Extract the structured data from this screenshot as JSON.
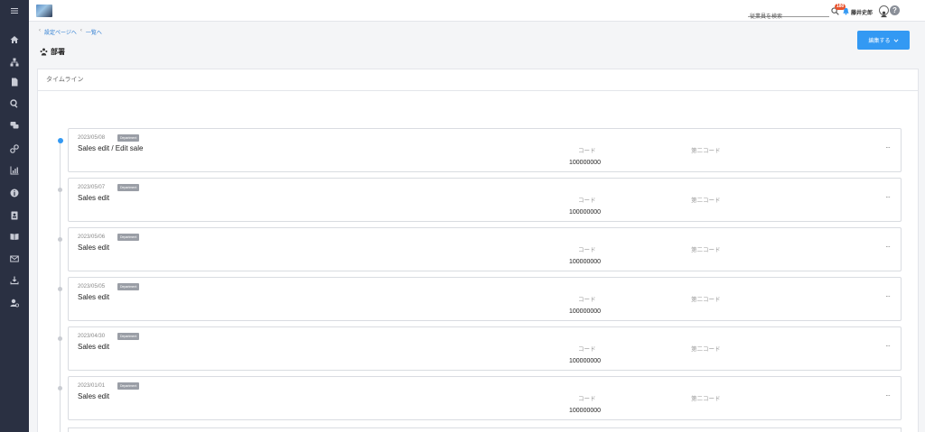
{
  "sidebar": {
    "items": [
      {
        "icon": "menu-icon"
      },
      {
        "icon": "home-icon"
      },
      {
        "icon": "org-chart-icon"
      },
      {
        "icon": "document-icon"
      },
      {
        "icon": "search-icon"
      },
      {
        "icon": "chat-icon"
      },
      {
        "icon": "link-icon"
      },
      {
        "icon": "chart-icon"
      },
      {
        "icon": "info-icon"
      },
      {
        "icon": "contact-book-icon"
      },
      {
        "icon": "book-icon"
      },
      {
        "icon": "mail-icon"
      },
      {
        "icon": "download-icon"
      },
      {
        "icon": "user-settings-icon"
      }
    ]
  },
  "topbar": {
    "search_placeholder": "従業員を検索",
    "notification_count": "180",
    "username": "藤井史郎",
    "help_label": "?"
  },
  "breadcrumb": {
    "items": [
      "設定ページへ",
      "一覧へ"
    ]
  },
  "page": {
    "title": "部署"
  },
  "panel": {
    "header": "タイムライン",
    "edit_button": "編集する"
  },
  "timeline": [
    {
      "date": "2023/05/08",
      "tag": "Department",
      "title": "Sales edit / Edit sale",
      "code_label": "コード",
      "code_value": "100000000",
      "code2_label": "第二コード",
      "more": "···",
      "active": true
    },
    {
      "date": "2023/05/07",
      "tag": "Department",
      "title": "Sales edit",
      "code_label": "コード",
      "code_value": "100000000",
      "code2_label": "第二コード",
      "more": "···",
      "active": false
    },
    {
      "date": "2023/05/06",
      "tag": "Department",
      "title": "Sales edit",
      "code_label": "コード",
      "code_value": "100000000",
      "code2_label": "第二コード",
      "more": "···",
      "active": false
    },
    {
      "date": "2023/05/05",
      "tag": "Department",
      "title": "Sales edit",
      "code_label": "コード",
      "code_value": "100000000",
      "code2_label": "第二コード",
      "more": "···",
      "active": false
    },
    {
      "date": "2023/04/30",
      "tag": "Department",
      "title": "Sales edit",
      "code_label": "コード",
      "code_value": "100000000",
      "code2_label": "第二コード",
      "more": "···",
      "active": false
    },
    {
      "date": "2023/01/01",
      "tag": "Department",
      "title": "Sales edit",
      "code_label": "コード",
      "code_value": "100000000",
      "code2_label": "第二コード",
      "more": "···",
      "active": false
    }
  ],
  "colors": {
    "sidebar_bg": "#2a3042",
    "accent": "#3399f3",
    "badge": "#e8542f",
    "tag_bg": "#9a9ea6"
  }
}
